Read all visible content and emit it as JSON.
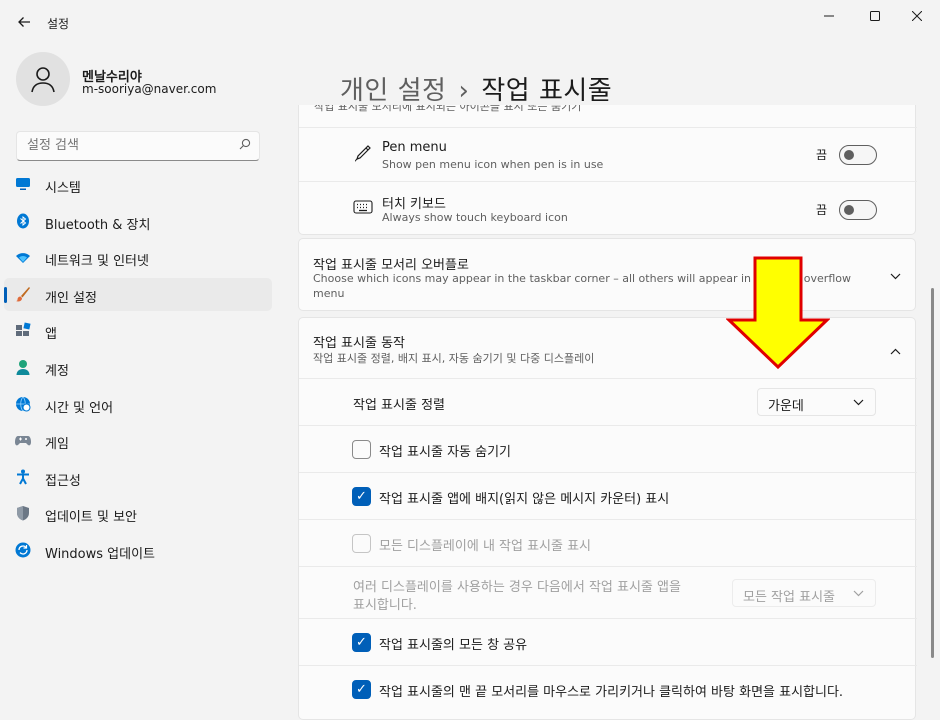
{
  "titlebar": {
    "back_icon": "arrow-left-icon",
    "title": "설정",
    "minimize_icon": "minimize-icon",
    "maximize_icon": "maximize-icon",
    "close_icon": "close-icon"
  },
  "profile": {
    "name": "멘날수리야",
    "email": "m-sooriya@naver.com"
  },
  "search": {
    "placeholder": "설정 검색"
  },
  "sidebar": {
    "items": [
      {
        "label": "시스템",
        "icon": "monitor-icon"
      },
      {
        "label": "Bluetooth & 장치",
        "icon": "bluetooth-icon"
      },
      {
        "label": "네트워크 및 인터넷",
        "icon": "wifi-icon"
      },
      {
        "label": "개인 설정",
        "icon": "brush-icon",
        "selected": true
      },
      {
        "label": "앱",
        "icon": "apps-icon"
      },
      {
        "label": "계정",
        "icon": "person-icon"
      },
      {
        "label": "시간 및 언어",
        "icon": "globe-clock-icon"
      },
      {
        "label": "게임",
        "icon": "gamepad-icon"
      },
      {
        "label": "접근성",
        "icon": "accessibility-icon"
      },
      {
        "label": "업데이트 및 보안",
        "icon": "shield-icon"
      },
      {
        "label": "Windows 업데이트",
        "icon": "update-icon"
      }
    ]
  },
  "breadcrumb": {
    "parent": "개인 설정",
    "separator": "›",
    "current": "작업 표시줄"
  },
  "content": {
    "clipped_header": "작업 표시줄 모서리에 표시되는 아이콘을 표시 또는 숨기기",
    "pen_menu": {
      "title": "Pen menu",
      "subtitle": "Show pen menu icon when pen is in use",
      "state": "끔",
      "icon": "pen-icon"
    },
    "touch_keyboard": {
      "title": "터치 키보드",
      "subtitle": "Always show touch keyboard icon",
      "state": "끔",
      "icon": "keyboard-icon"
    },
    "overflow": {
      "title": "작업 표시줄 모서리 오버플로",
      "subtitle_line1": "Choose which icons may appear in the taskbar corner – all others will appear in the tas",
      "subtitle_tail": "er overflow",
      "subtitle_line2": "menu"
    },
    "behaviors": {
      "title": "작업 표시줄 동작",
      "subtitle": "작업 표시줄 정렬, 배지 표시, 자동 숨기기 및 다중 디스플레이",
      "alignment_label": "작업 표시줄 정렬",
      "alignment_value": "가운데",
      "auto_hide": "작업 표시줄 자동 숨기기",
      "badges": "작업 표시줄 앱에 배지(읽지 않은 메시지 카운터) 표시",
      "all_displays": "모든 디스플레이에 내 작업 표시줄 표시",
      "multi_display_line1": "여러 디스플레이를 사용하는 경우 다음에서 작업 표시줄 앱을",
      "multi_display_line2": "표시합니다.",
      "multi_display_value": "모든 작업 표시줄",
      "share_windows": "작업 표시줄의 모든 창 공유",
      "far_corner": "작업 표시줄의 맨 끝 모서리를 마우스로 가리키거나 클릭하여 바탕 화면을 표시합니다."
    }
  },
  "colors": {
    "accent": "#005fb8",
    "annotation_arrow_fill": "#ffff00",
    "annotation_arrow_stroke": "#e00000"
  },
  "annotation": {
    "arrow_icon": "down-arrow-annotation"
  }
}
